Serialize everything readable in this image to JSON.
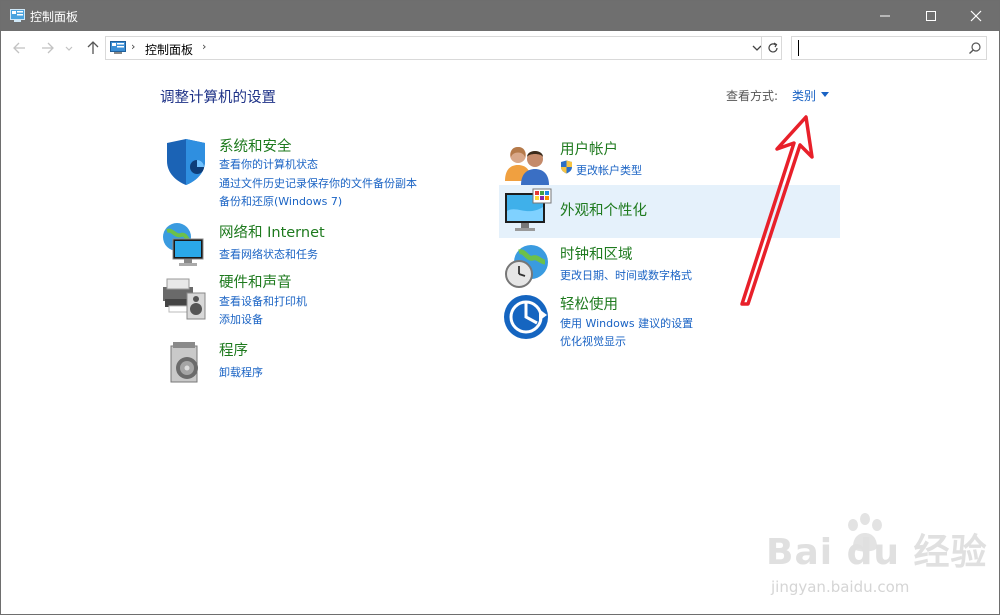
{
  "window": {
    "title": "控制面板"
  },
  "address_bar": {
    "breadcrumb": "控制面板",
    "search_value": ""
  },
  "header": {
    "title": "调整计算机的设置",
    "view_by_label": "查看方式:",
    "view_by_value": "类别"
  },
  "categories": {
    "system": {
      "title": "系统和安全",
      "links": [
        "查看你的计算机状态",
        "通过文件历史记录保存你的文件备份副本",
        "备份和还原(Windows 7)"
      ]
    },
    "network": {
      "title": "网络和 Internet",
      "links": [
        "查看网络状态和任务"
      ]
    },
    "hardware": {
      "title": "硬件和声音",
      "links": [
        "查看设备和打印机",
        "添加设备"
      ]
    },
    "programs": {
      "title": "程序",
      "links": [
        "卸载程序"
      ]
    },
    "accounts": {
      "title": "用户帐户",
      "links": [
        "更改帐户类型"
      ]
    },
    "appearance": {
      "title": "外观和个性化",
      "links": []
    },
    "clock": {
      "title": "时钟和区域",
      "links": [
        "更改日期、时间或数字格式"
      ]
    },
    "ease": {
      "title": "轻松使用",
      "links": [
        "使用 Windows 建议的设置",
        "优化视觉显示"
      ]
    }
  },
  "watermark": {
    "main": "Bai du 经验",
    "sub": "jingyan.baidu.com"
  },
  "colors": {
    "titlebar": "#6f6f6f",
    "link": "#1a63c4",
    "category_title": "#1e7a1e",
    "page_title": "#1e3287",
    "highlight": "#e5f1fb",
    "annotation_arrow": "#e8202a"
  }
}
